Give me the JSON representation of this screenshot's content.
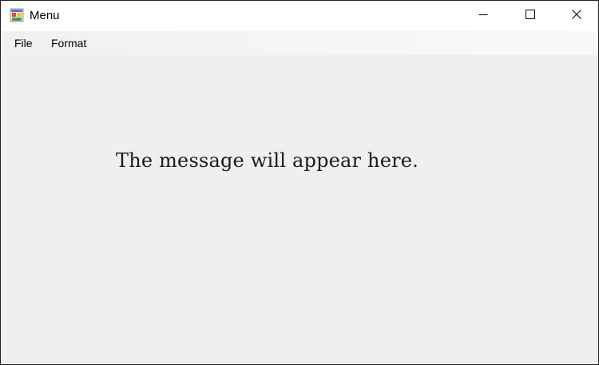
{
  "window": {
    "title": "Menu",
    "app_icon": "winforms-app-icon",
    "controls": {
      "minimize_icon": "minimize-icon",
      "maximize_icon": "maximize-icon",
      "close_icon": "close-icon"
    }
  },
  "menubar": {
    "items": [
      {
        "label": "File"
      },
      {
        "label": "Format"
      }
    ]
  },
  "content": {
    "message": "The message will appear here."
  },
  "colors": {
    "titlebar_bg": "#ffffff",
    "client_bg": "#efefef",
    "text": "#000000"
  }
}
